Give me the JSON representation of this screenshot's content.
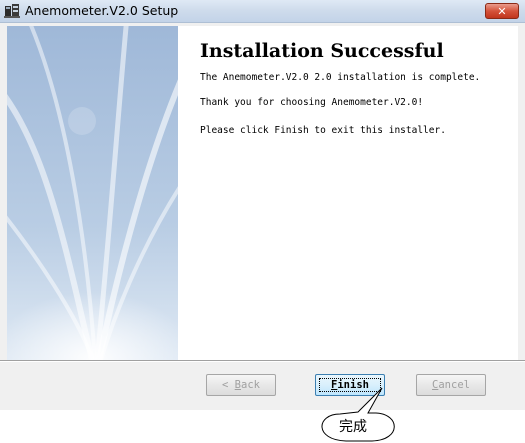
{
  "window": {
    "title": "Anemometer.V2.0 Setup",
    "close_label": "✕"
  },
  "content": {
    "heading": "Installation Successful",
    "line1": "The Anemometer.V2.0 2.0 installation is complete.",
    "line2": "Thank you for choosing Anemometer.V2.0!",
    "line3": "Please click Finish to exit this installer."
  },
  "buttons": {
    "back_prefix": "< ",
    "back_mnemonic": "B",
    "back_rest": "ack",
    "finish_mnemonic": "F",
    "finish_rest": "inish",
    "cancel_mnemonic": "C",
    "cancel_rest": "ancel"
  },
  "annotation": {
    "label": "完成"
  },
  "colors": {
    "titlebar": "#cfdcec",
    "side_panel": "#b8cbe2",
    "close_button": "#c1351d",
    "dialog_background": "#f0f0f0"
  }
}
